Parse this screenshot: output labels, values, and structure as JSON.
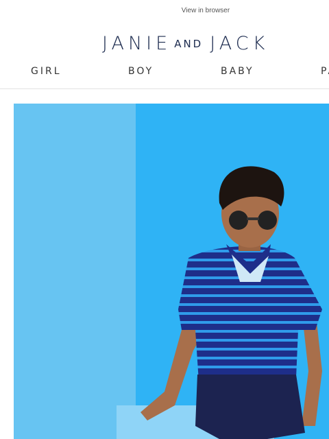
{
  "header": {
    "view_in_browser": "View in browser",
    "logo": {
      "part1": "JANIE",
      "part2": "AND",
      "part3": "JACK"
    }
  },
  "nav": {
    "items": [
      {
        "label": "GIRL"
      },
      {
        "label": "BOY"
      },
      {
        "label": "BABY"
      },
      {
        "label": "PA"
      }
    ]
  },
  "colors": {
    "brand_navy": "#1b2a4e",
    "hero_left_bg": "#67c4f2",
    "hero_right_bg": "#2fb3f5"
  }
}
